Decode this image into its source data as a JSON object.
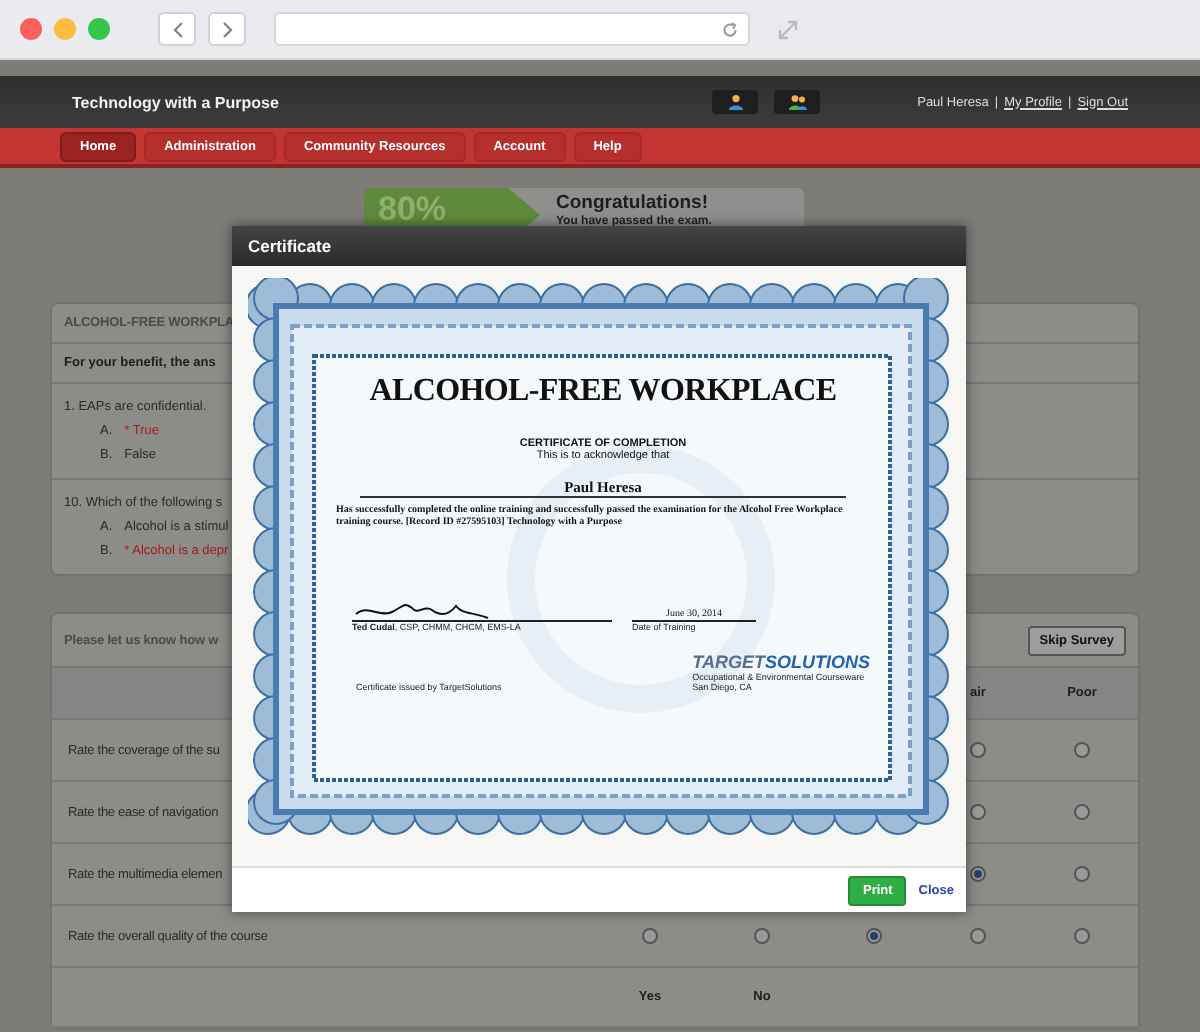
{
  "header": {
    "brand": "Technology with a Purpose",
    "user": "Paul Heresa",
    "links": [
      {
        "separator": "|",
        "label": "My Profile"
      },
      {
        "separator": "|",
        "label": "Sign Out"
      }
    ]
  },
  "nav": [
    {
      "label": "Home",
      "selected": true
    },
    {
      "label": "Administration",
      "selected": false
    },
    {
      "label": "Community Resources",
      "selected": false
    },
    {
      "label": "Account",
      "selected": false
    },
    {
      "label": "Help",
      "selected": false
    }
  ],
  "score": {
    "percent": "80%",
    "title": "Congratulations!",
    "message": "You have passed the exam."
  },
  "results": {
    "title": "ALCOHOL-FREE WORKPLA",
    "note": "For your benefit, the ans",
    "questions": [
      {
        "text": "1. EAPs are confidential.",
        "answers": [
          {
            "letter": "A.",
            "text": "* True",
            "correct": true
          },
          {
            "letter": "B.",
            "text": "False",
            "correct": false
          }
        ]
      },
      {
        "text": "10. Which of the following s",
        "answers": [
          {
            "letter": "A.",
            "text": "Alcohol is a stimul",
            "correct": false
          },
          {
            "letter": "B.",
            "text": "* Alcohol is a depr",
            "correct": true
          }
        ]
      }
    ]
  },
  "survey": {
    "prompt": "Please let us know how w",
    "skip": "Skip Survey",
    "columns": [
      "air",
      "Poor"
    ],
    "rows": [
      {
        "label": "Rate the coverage of the su",
        "options": [
          {
            "selected": false
          },
          {
            "selected": false
          }
        ]
      },
      {
        "label": "Rate the ease of navigation",
        "options": [
          {
            "selected": false
          },
          {
            "selected": false
          }
        ]
      },
      {
        "label": "Rate the multimedia elemen",
        "options": [
          {
            "selected": true
          },
          {
            "selected": false
          }
        ]
      },
      {
        "label": "Rate the overall quality of the course",
        "options": [
          {
            "selected": false
          },
          {
            "selected": false
          },
          {
            "selected": true
          },
          {
            "selected": false
          },
          {
            "selected": false
          }
        ]
      }
    ],
    "footer": [
      "Yes",
      "No"
    ]
  },
  "dialog": {
    "title": "Certificate",
    "certificate": {
      "course": "ALCOHOL-FREE WORKPLACE",
      "heading": "CERTIFICATE OF COMPLETION",
      "intro": "This is to acknowledge that",
      "name": "Paul Heresa",
      "body": "Has successfully completed the online training and successfully passed the examination for the Alcohol Free Workplace training course. [Record ID #27595103] Technology with a Purpose",
      "signer": "**Ted Cudal**, CSP, CHMM, CHCM, EMS-LA",
      "date": "June 30, 2014",
      "date_label": "Date of Training",
      "issuer": "Certificate issued by TargetSolutions",
      "logo": [
        "TARGET",
        "SOLUTIONS"
      ],
      "tagline": "Occupational & Environmental Courseware",
      "city": "San Diego, CA"
    },
    "print": "Print",
    "close": "Close"
  }
}
